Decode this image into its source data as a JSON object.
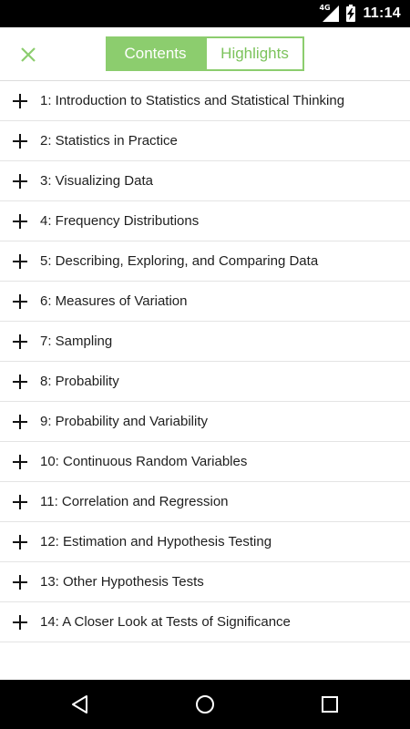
{
  "status_bar": {
    "network": "4G",
    "time": "11:14"
  },
  "header": {
    "tabs": [
      {
        "label": "Contents",
        "active": true
      },
      {
        "label": "Highlights",
        "active": false
      }
    ]
  },
  "chapters": [
    {
      "label": "1: Introduction to Statistics and Statistical Thinking"
    },
    {
      "label": "2: Statistics in Practice"
    },
    {
      "label": "3: Visualizing Data"
    },
    {
      "label": "4: Frequency Distributions"
    },
    {
      "label": "5: Describing, Exploring, and Comparing Data"
    },
    {
      "label": "6: Measures of Variation"
    },
    {
      "label": "7: Sampling"
    },
    {
      "label": "8: Probability"
    },
    {
      "label": "9: Probability and Variability"
    },
    {
      "label": "10: Continuous Random Variables"
    },
    {
      "label": "11: Correlation and Regression"
    },
    {
      "label": "12: Estimation and Hypothesis Testing"
    },
    {
      "label": "13: Other Hypothesis Tests"
    },
    {
      "label": "14: A Closer Look at Tests of Significance"
    }
  ],
  "icons": {
    "close": "close-icon",
    "expand": "plus-icon",
    "back": "back-triangle-icon",
    "home": "home-circle-icon",
    "recents": "recents-square-icon"
  },
  "colors": {
    "accent": "#8ccd6e",
    "status_bar": "#000000",
    "nav_bar": "#000000"
  }
}
